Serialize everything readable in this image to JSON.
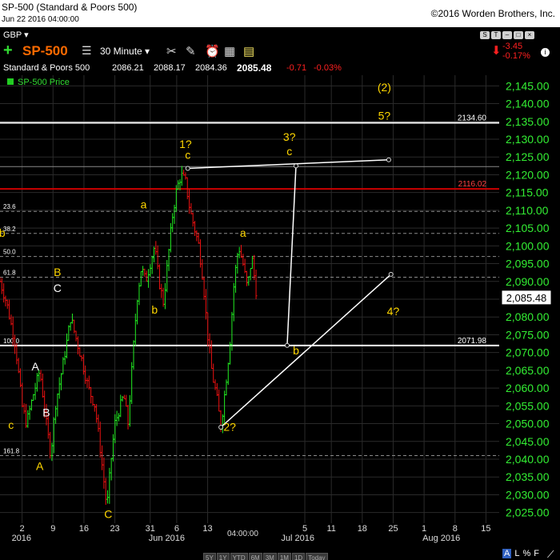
{
  "window": {
    "title": "SP-500 (Standard & Poors 500)",
    "datetime": "Jun 22 2016 04:00:00",
    "copyright": "©2016 Worden Brothers, Inc."
  },
  "toolbar": {
    "currency": "GBP",
    "symbol": "SP-500",
    "interval": "30 Minute",
    "change_abs": "-3.45",
    "change_pct": "-0.17%"
  },
  "quote": {
    "name": "Standard & Poors 500",
    "open": "2086.21",
    "high": "2088.17",
    "low": "2084.36",
    "last": "2085.48",
    "change": "-0.71",
    "change_pct": "-0.03%"
  },
  "legend": {
    "series_label": "SP-500 Price"
  },
  "bottom_bar": {
    "cursor_time": "04:00:00",
    "timeframes": [
      "5Y",
      "1Y",
      "YTD",
      "6M",
      "3M",
      "1M",
      "1D",
      "Today"
    ],
    "scale_buttons": [
      "A",
      "L",
      "%",
      "F"
    ]
  },
  "colors": {
    "up": "#22ee22",
    "down": "#ee1111",
    "annotation": "#ffd700",
    "white_line": "#ffffff",
    "red_line": "#cc0000"
  },
  "chart_data": {
    "type": "line",
    "ylim": [
      2022,
      2148
    ],
    "y_ticks": [
      2025,
      2030,
      2035,
      2040,
      2045,
      2050,
      2055,
      2060,
      2065,
      2070,
      2075,
      2080,
      2085,
      2090,
      2095,
      2100,
      2105,
      2110,
      2115,
      2120,
      2125,
      2130,
      2135,
      2140,
      2145
    ],
    "y_tick_labels": [
      "2,025.00",
      "2,030.00",
      "2,035.00",
      "2,040.00",
      "2,045.00",
      "2,050.00",
      "2,055.00",
      "2,060.00",
      "2,065.00",
      "2,070.00",
      "2,075.00",
      "2,080.00",
      "2,085.00",
      "2,090.00",
      "2,095.00",
      "2,100.00",
      "2,105.00",
      "2,110.00",
      "2,115.00",
      "2,120.00",
      "2,125.00",
      "2,130.00",
      "2,135.00",
      "2,140.00",
      "2,145.00"
    ],
    "last_price_label": "2,085.48",
    "last_price": 2085.48,
    "x_ticks": [
      {
        "label": "2",
        "day": 2
      },
      {
        "label": "9",
        "day": 9
      },
      {
        "label": "16",
        "day": 16
      },
      {
        "label": "23",
        "day": 23
      },
      {
        "label": "31",
        "day": 31
      },
      {
        "label": "6",
        "day": 37
      },
      {
        "label": "13",
        "day": 44
      },
      {
        "label": "5",
        "day": 66
      },
      {
        "label": "11",
        "day": 72
      },
      {
        "label": "18",
        "day": 79
      },
      {
        "label": "25",
        "day": 86
      },
      {
        "label": "1",
        "day": 93
      },
      {
        "label": "8",
        "day": 100
      },
      {
        "label": "15",
        "day": 107
      }
    ],
    "month_labels": [
      {
        "label": "2016",
        "day": 0
      },
      {
        "label": "Jun 2016",
        "day": 31
      },
      {
        "label": "Jul 2016",
        "day": 61
      },
      {
        "label": "Aug 2016",
        "day": 93
      }
    ],
    "x_day_range": [
      -3,
      110
    ],
    "price_path": [
      [
        -3,
        2090
      ],
      [
        -1.5,
        2084
      ],
      [
        0.5,
        2072
      ],
      [
        2,
        2055
      ],
      [
        3,
        2050
      ],
      [
        4.5,
        2058
      ],
      [
        6,
        2065
      ],
      [
        7.5,
        2050
      ],
      [
        8.5,
        2041
      ],
      [
        9.5,
        2055
      ],
      [
        11,
        2065
      ],
      [
        12,
        2072
      ],
      [
        13,
        2080
      ],
      [
        14,
        2075
      ],
      [
        15.5,
        2068
      ],
      [
        17,
        2060
      ],
      [
        18.5,
        2055
      ],
      [
        19.5,
        2045
      ],
      [
        20.5,
        2034
      ],
      [
        21.2,
        2026
      ],
      [
        22,
        2038
      ],
      [
        23,
        2050
      ],
      [
        24,
        2054
      ],
      [
        25,
        2058
      ],
      [
        26,
        2050
      ],
      [
        27,
        2068
      ],
      [
        28,
        2085
      ],
      [
        29,
        2094
      ],
      [
        30,
        2090
      ],
      [
        31,
        2095
      ],
      [
        32,
        2100
      ],
      [
        33,
        2090
      ],
      [
        34,
        2084
      ],
      [
        35,
        2096
      ],
      [
        36,
        2108
      ],
      [
        37,
        2116
      ],
      [
        38,
        2120
      ],
      [
        39,
        2118
      ],
      [
        40,
        2110
      ],
      [
        41,
        2105
      ],
      [
        42,
        2100
      ],
      [
        43,
        2090
      ],
      [
        44,
        2075
      ],
      [
        45,
        2064
      ],
      [
        46,
        2058
      ],
      [
        47,
        2049
      ],
      [
        48,
        2060
      ],
      [
        49,
        2072
      ],
      [
        50,
        2090
      ],
      [
        51,
        2100
      ],
      [
        52,
        2095
      ],
      [
        53,
        2088
      ],
      [
        54,
        2097
      ],
      [
        55,
        2087
      ]
    ],
    "horizontal_lines": [
      {
        "value": 2134.6,
        "label": "2134.60",
        "color": "#ffffff",
        "width": 2
      },
      {
        "value": 2116.02,
        "label": "2116.02",
        "color": "#cc0000",
        "width": 2
      },
      {
        "value": 2071.98,
        "label": "2071.98",
        "color": "#ffffff",
        "width": 2
      },
      {
        "value": 2122.3,
        "label": "",
        "color": "#888888",
        "width": 1
      }
    ],
    "fib_lines": [
      {
        "value": 2109.7,
        "label": "23.6"
      },
      {
        "value": 2103.5,
        "label": "38.2"
      },
      {
        "value": 2097.0,
        "label": "50.0"
      },
      {
        "value": 2091.2,
        "label": "61.8"
      },
      {
        "value": 2072.0,
        "label": "100.0"
      },
      {
        "value": 2041.0,
        "label": "161.8"
      }
    ],
    "trend_lines": [
      {
        "points": [
          [
            39.5,
            2121.8
          ],
          [
            85,
            2124.2
          ]
        ]
      },
      {
        "points": [
          [
            64,
            2122.5
          ],
          [
            62,
            2072
          ]
        ]
      },
      {
        "points": [
          [
            47,
            2049
          ],
          [
            85.5,
            2092
          ]
        ]
      }
    ],
    "annotations": [
      {
        "text": "(2)",
        "day": 84,
        "value": 2143.5,
        "color": "#ffd700"
      },
      {
        "text": "5?",
        "day": 84,
        "value": 2135.5,
        "color": "#ffd700"
      },
      {
        "text": "3?",
        "day": 62.5,
        "value": 2129.5,
        "color": "#ffd700"
      },
      {
        "text": "c",
        "day": 62.5,
        "value": 2125.5,
        "color": "#ffd700"
      },
      {
        "text": "1?",
        "day": 39,
        "value": 2127.5,
        "color": "#ffd700"
      },
      {
        "text": "c",
        "day": 39.5,
        "value": 2124.5,
        "color": "#ffd700"
      },
      {
        "text": "a",
        "day": 29.5,
        "value": 2110.5,
        "color": "#ffd700"
      },
      {
        "text": "b",
        "day": 32,
        "value": 2081,
        "color": "#ffd700"
      },
      {
        "text": "a",
        "day": 52,
        "value": 2102.5,
        "color": "#ffd700"
      },
      {
        "text": "b",
        "day": 64,
        "value": 2069.5,
        "color": "#ffd700"
      },
      {
        "text": "4?",
        "day": 86,
        "value": 2080.5,
        "color": "#ffd700"
      },
      {
        "text": "2?",
        "day": 49,
        "value": 2048,
        "color": "#ffd700"
      },
      {
        "text": "B",
        "day": 10,
        "value": 2091.5,
        "color": "#ffd700"
      },
      {
        "text": "C",
        "day": 10,
        "value": 2087,
        "color": "#ffffff"
      },
      {
        "text": "A",
        "day": 5,
        "value": 2065,
        "color": "#ffffff"
      },
      {
        "text": "B",
        "day": 7.5,
        "value": 2052,
        "color": "#ffffff"
      },
      {
        "text": "c",
        "day": -0.5,
        "value": 2048.5,
        "color": "#ffd700"
      },
      {
        "text": "A",
        "day": 6,
        "value": 2037,
        "color": "#ffd700"
      },
      {
        "text": "C",
        "day": 21.5,
        "value": 2023.5,
        "color": "#ffd700"
      },
      {
        "text": "b",
        "day": -2.5,
        "value": 2102.5,
        "color": "#ffd700"
      }
    ]
  }
}
